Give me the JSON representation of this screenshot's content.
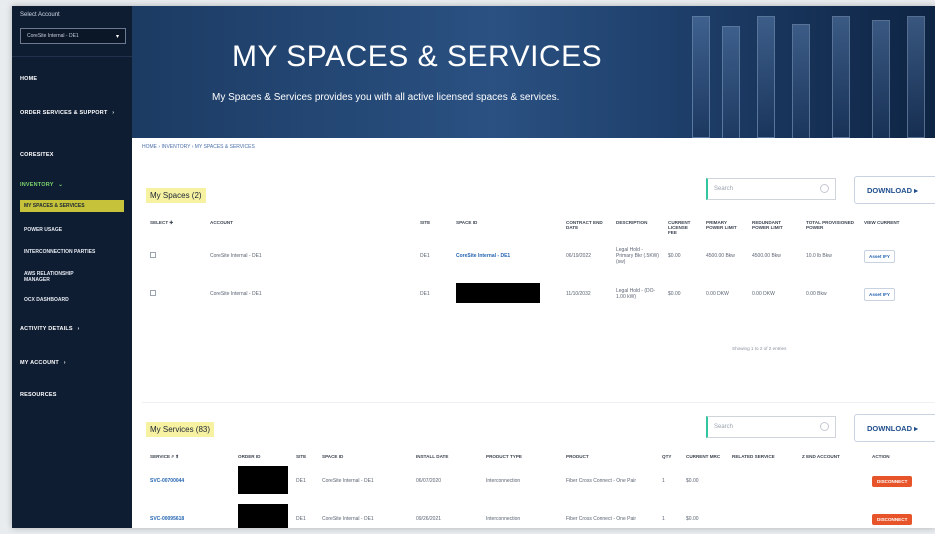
{
  "sidebar": {
    "account_label": "Select Account",
    "account_value": "CoreSite Internal - DE1",
    "items": [
      {
        "label": "HOME"
      },
      {
        "label": "ORDER SERVICES & SUPPORT",
        "chevron": "›"
      },
      {
        "label": "CORESITEX"
      },
      {
        "label": "INVENTORY",
        "chevron": "⌄"
      },
      {
        "label": "ACTIVITY DETAILS",
        "chevron": "›"
      },
      {
        "label": "MY ACCOUNT",
        "chevron": "›"
      },
      {
        "label": "RESOURCES"
      }
    ],
    "inventory_sub": [
      {
        "label": "MY SPACES & SERVICES"
      },
      {
        "label": "POWER USAGE"
      },
      {
        "label": "INTERCONNECTION PARTIES"
      },
      {
        "label": "AWS RELATIONSHIP MANAGER"
      },
      {
        "label": "OCX DASHBOARD"
      }
    ]
  },
  "hero": {
    "title": "MY SPACES & SERVICES",
    "subtitle": "My Spaces & Services provides you with all active licensed spaces & services."
  },
  "breadcrumb": "HOME  ›  INVENTORY  ›  MY SPACES & SERVICES",
  "spaces": {
    "title": "My Spaces (2)",
    "search_placeholder": "Search",
    "download_label": "DOWNLOAD ▸",
    "columns": [
      "SELECT ✚",
      "ACCOUNT",
      "SITE",
      "SPACE ID",
      "CONTRACT END DATE",
      "DESCRIPTION",
      "CURRENT LICENSE FEE",
      "PRIMARY POWER LIMIT",
      "REDUNDANT POWER LIMIT",
      "TOTAL PROVISIONED POWER",
      "VIEW CURRENT"
    ],
    "rows": [
      {
        "account": "CoreSite Internal - DE1",
        "site": "DE1",
        "space_id": "CoreSite Internal - DE1",
        "end_date": "06/19/2022",
        "description": "Legal Hold - Primary Bkr (.5KW) (sw)",
        "fee": "$0.00",
        "primary": "4500.00 Bkw",
        "redundant": "4500.00 Bkw",
        "total": "10.0 lb Bkw",
        "action": "Asset IFY"
      },
      {
        "account": "CoreSite Internal - DE1",
        "site": "DE1",
        "space_id": "",
        "end_date": "11/10/2032",
        "description": "Legal Hold - (DO-1.00 kW)",
        "fee": "$0.00",
        "primary": "0.00 DKW",
        "redundant": "0.00 DKW",
        "total": "0.00 Bkw",
        "action": "Asset IFY"
      }
    ],
    "paging": "Showing 1 to 2 of 2 entries"
  },
  "services": {
    "title": "My Services (83)",
    "search_placeholder": "Search",
    "download_label": "DOWNLOAD ▸",
    "columns": [
      "SERVICE # ⬆",
      "ORDER ID",
      "SITE",
      "SPACE ID",
      "INSTALL DATE",
      "PRODUCT TYPE",
      "PRODUCT",
      "QTY",
      "CURRENT MRC",
      "RELATED SERVICE",
      "Z END ACCOUNT",
      "ACTION"
    ],
    "rows": [
      {
        "service": "SVC-00700044",
        "site": "DE1",
        "space": "CoreSite Internal - DE1",
        "install": "06/07/2020",
        "type": "Interconnection",
        "product": "Fiber Cross Connect - One Pair",
        "qty": "1",
        "mrc": "$0.00",
        "action": "DISCONNECT"
      },
      {
        "service": "SVC-00095618",
        "site": "DE1",
        "space": "CoreSite Internal - DE1",
        "install": "09/26/2021",
        "type": "Interconnection",
        "product": "Fiber Cross Connect - One Pair",
        "qty": "1",
        "mrc": "$0.00",
        "action": "DISCONNECT"
      }
    ]
  },
  "colors": {
    "sidebar_bg": "#0f1d33",
    "highlight": "#f7f1a2",
    "accent_green": "#7bd36c",
    "action_red": "#e8542a",
    "link_blue": "#2565b0"
  }
}
